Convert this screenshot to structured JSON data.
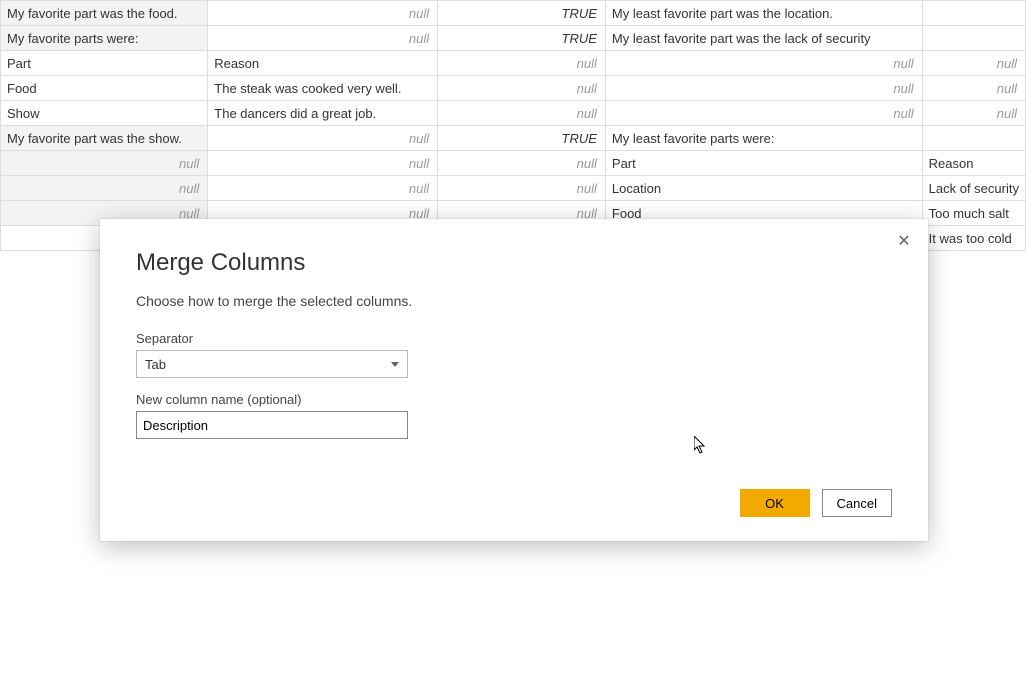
{
  "null_label": "null",
  "true_label": "TRUE",
  "table": {
    "rows": [
      {
        "c1": "My favorite part was the food.",
        "c1null": false,
        "c1hdr": true,
        "c2": null,
        "c3": "TRUE",
        "c4": "My least favorite part was the location.",
        "c5": ""
      },
      {
        "c1": "My favorite parts were:",
        "c1null": false,
        "c1hdr": true,
        "c2": null,
        "c3": "TRUE",
        "c4": "My least favorite part was  the lack of security",
        "c5": ""
      },
      {
        "c1": "Part",
        "c1null": false,
        "c1hdr": false,
        "c2": "Reason",
        "c3": null,
        "c4": null,
        "c5": null
      },
      {
        "c1": "Food",
        "c1null": false,
        "c1hdr": false,
        "c2": "The steak was cooked very well.",
        "c3": null,
        "c4": null,
        "c5": null
      },
      {
        "c1": "Show",
        "c1null": false,
        "c1hdr": false,
        "c2": "The dancers did a great job.",
        "c3": null,
        "c4": null,
        "c5": null
      },
      {
        "c1": "My favorite part was the show.",
        "c1null": false,
        "c1hdr": true,
        "c2": null,
        "c3": "TRUE",
        "c4": "My least favorite parts were:",
        "c5": ""
      },
      {
        "c1": null,
        "c1null": true,
        "c1hdr": true,
        "c2": null,
        "c3": null,
        "c4": "Part",
        "c5": "Reason"
      },
      {
        "c1": null,
        "c1null": true,
        "c1hdr": true,
        "c2": null,
        "c3": null,
        "c4": "Location",
        "c5": "Lack of security"
      },
      {
        "c1": null,
        "c1null": true,
        "c1hdr": true,
        "c2": null,
        "c3": null,
        "c4": "Food",
        "c5": "Too much salt"
      },
      {
        "c1": "",
        "c1null": false,
        "c1hdr": false,
        "c1blank": true,
        "c2": "",
        "c3": "",
        "c4": "",
        "c5": "It was too cold"
      }
    ]
  },
  "dialog": {
    "title": "Merge Columns",
    "subtitle": "Choose how to merge the selected columns.",
    "separator_label": "Separator",
    "separator_value": "Tab",
    "newcol_label": "New column name (optional)",
    "newcol_value": "Description",
    "ok": "OK",
    "cancel": "Cancel"
  }
}
